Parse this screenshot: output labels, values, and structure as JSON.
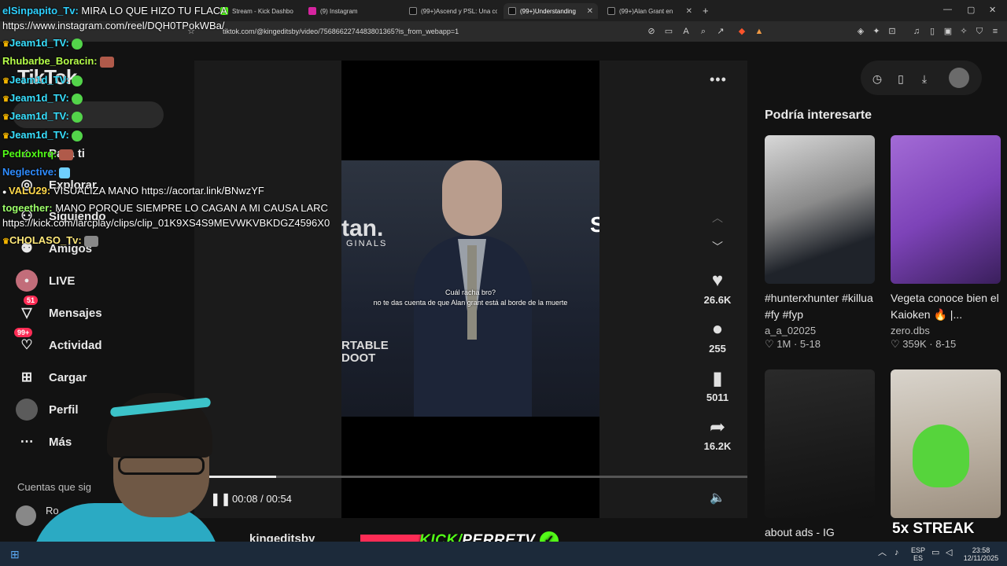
{
  "browser": {
    "tabs": [
      {
        "label": "Stream - Kick Dashbo",
        "active": false
      },
      {
        "label": "(9) Instagram",
        "active": false
      },
      {
        "label": "(99+)Ascend y PSL: Una co",
        "active": false
      },
      {
        "label": "(99+)Understanding",
        "active": true
      },
      {
        "label": "(99+)Alan Grant en",
        "active": false
      }
    ],
    "new_tab": "+",
    "url": "tiktok.com/@kingeditsby/video/7568662274483801365?is_from_webapp=1"
  },
  "tiktok": {
    "logo": "TikTok",
    "nav": [
      {
        "label": "Para ti",
        "icon": "home-icon"
      },
      {
        "label": "Explorar",
        "icon": "compass-icon"
      },
      {
        "label": "Siguiendo",
        "icon": "following-icon"
      },
      {
        "label": "Amigos",
        "icon": "friends-icon"
      },
      {
        "label": "LIVE",
        "icon": "live-icon"
      },
      {
        "label": "Mensajes",
        "icon": "messages-icon",
        "badge": "51"
      },
      {
        "label": "Actividad",
        "icon": "activity-icon",
        "badge": "99+"
      },
      {
        "label": "Cargar",
        "icon": "upload-icon"
      },
      {
        "label": "Perfil",
        "icon": "profile-avatar"
      },
      {
        "label": "Más",
        "icon": "more-icon"
      }
    ],
    "following_title": "Cuentas que sig",
    "following_first": "Ro",
    "video": {
      "caption_line1": "Cuál racha bro?",
      "caption_line2": "no te das cuenta de que Alan grant está al borde de la muerte",
      "bg_text": "tan.",
      "bg_text2": "GINALS",
      "bg_text3": "RTABLE DOOT",
      "bg_text_right": "S",
      "likes": "26.6K",
      "comments": "255",
      "saves": "5011",
      "shares": "16.2K",
      "time": "00:08 / 00:54",
      "progress": 0.148,
      "author": "kingeditsby"
    },
    "recommendations": {
      "title": "Podría interesarte",
      "items": [
        {
          "desc": "#hunterxhunter #killua #fy #fyp",
          "author": "a_a_02025",
          "likes": "1M",
          "date": "5-18"
        },
        {
          "desc": "Vegeta conoce bien el Kaioken 🔥 |...",
          "author": "zero.dbs",
          "likes": "359K",
          "date": "8-15"
        },
        {
          "desc": "about ads - IG",
          "author": "",
          "likes": "",
          "date": ""
        },
        {
          "desc": "5x STREAK",
          "author": "",
          "likes": "",
          "date": ""
        }
      ]
    }
  },
  "chat": [
    {
      "user": "elSinpapito_Tv:",
      "msg": "MIRA LO QUE HIZO TU FLACA",
      "color": "#2fd1ff",
      "crown": false
    },
    {
      "user": "",
      "msg": "https://www.instagram.com/reel/DQH0TPokWBa/",
      "color": "#ffffff",
      "crown": false
    },
    {
      "user": "Jeam1d_TV:",
      "msg": "",
      "color": "#39e0ff",
      "crown": true,
      "emote": true
    },
    {
      "user": "Rhubarbe_Boracin:",
      "msg": "",
      "color": "#b6ff4a",
      "crown": false,
      "emote": true
    },
    {
      "user": "Jeam1d_TV:",
      "msg": "",
      "color": "#39e0ff",
      "crown": true,
      "emote": true
    },
    {
      "user": "Jeam1d_TV:",
      "msg": "",
      "color": "#39e0ff",
      "crown": true,
      "emote": true
    },
    {
      "user": "Jeam1d_TV:",
      "msg": "",
      "color": "#39e0ff",
      "crown": true,
      "emote": true
    },
    {
      "user": "Jeam1d_TV:",
      "msg": "",
      "color": "#39e0ff",
      "crown": true,
      "emote": true
    },
    {
      "user": "Pedroxhrq:",
      "msg": "",
      "color": "#53fc18",
      "crown": false,
      "emote": true
    },
    {
      "user": "Neglective:",
      "msg": "",
      "color": "#2f8cff",
      "crown": false,
      "emote": true
    },
    {
      "user": "VALU29:",
      "msg": "VISUALIZA MANO https://acortar.link/BNwzYF",
      "color": "#ffd84a",
      "crown": false
    },
    {
      "user": "togeether:",
      "msg": "MANO PORQUE SIEMPRE LO CAGAN A MI CAUSA LARC",
      "color": "#9dff6a",
      "crown": false
    },
    {
      "user": "",
      "msg": "https://kick.com/larcplay/clips/clip_01K9XS4S9MEVWKVBKDGZ4596X0",
      "color": "#ffffff",
      "crown": false
    },
    {
      "user": "CHOLASO_Tv:",
      "msg": "",
      "color": "#ffe97a",
      "crown": true,
      "emote": true
    }
  ],
  "stream": {
    "kick_prefix": "KICK/",
    "kick_name": "PERRETV",
    "streak": "5x STREAK"
  },
  "taskbar": {
    "lang_top": "ESP",
    "lang_bottom": "ES",
    "time": "23:58",
    "date": "12/11/2025"
  },
  "colors": {
    "accent": "#fe2c55",
    "kick_green": "#53fc18",
    "bg": "#121212"
  }
}
